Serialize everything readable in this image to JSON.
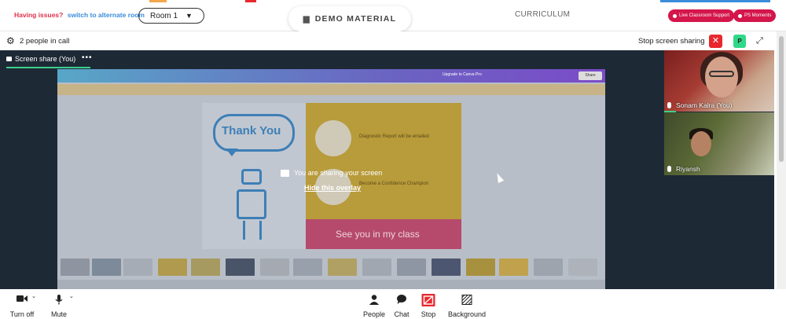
{
  "topbar": {
    "issue_prefix": "Having issues?",
    "issue_link": "switch to alternate room",
    "room_value": "Room 1",
    "demo_tab_label": "DEMO MATERIAL",
    "curriculum_label": "CURRICULUM",
    "support_button": "Live Classroom Support",
    "moments_button": "PS Moments"
  },
  "callbar": {
    "people_count": "2 people in call",
    "stop_sharing_label": "Stop screen sharing",
    "pin_letter": "P"
  },
  "stage": {
    "share_tab_label": "Screen share (You)",
    "overlay_message": "You are sharing your screen",
    "hide_overlay_link": "Hide this overlay",
    "shared_screen": {
      "slide_title": "Thank You",
      "slide_item_1": "Diagnostic Report will be emailed",
      "slide_item_2": "Become a Confidence Champion",
      "slide_footer": "See you in my class",
      "upgrade_text": "Upgrade to Canva Pro",
      "share_text": "Share"
    }
  },
  "participants": [
    {
      "name": "Sonam Kalra (You)"
    },
    {
      "name": "Riyansh"
    }
  ],
  "controls": {
    "camera": "Turn off",
    "mic": "Mute",
    "people": "People",
    "chat": "Chat",
    "stop": "Stop",
    "background": "Background"
  },
  "colors": {
    "accent_red": "#e8282e",
    "accent_green": "#3ad08a",
    "stage_bg": "#1e2936",
    "brand_pink": "#d4164b"
  }
}
